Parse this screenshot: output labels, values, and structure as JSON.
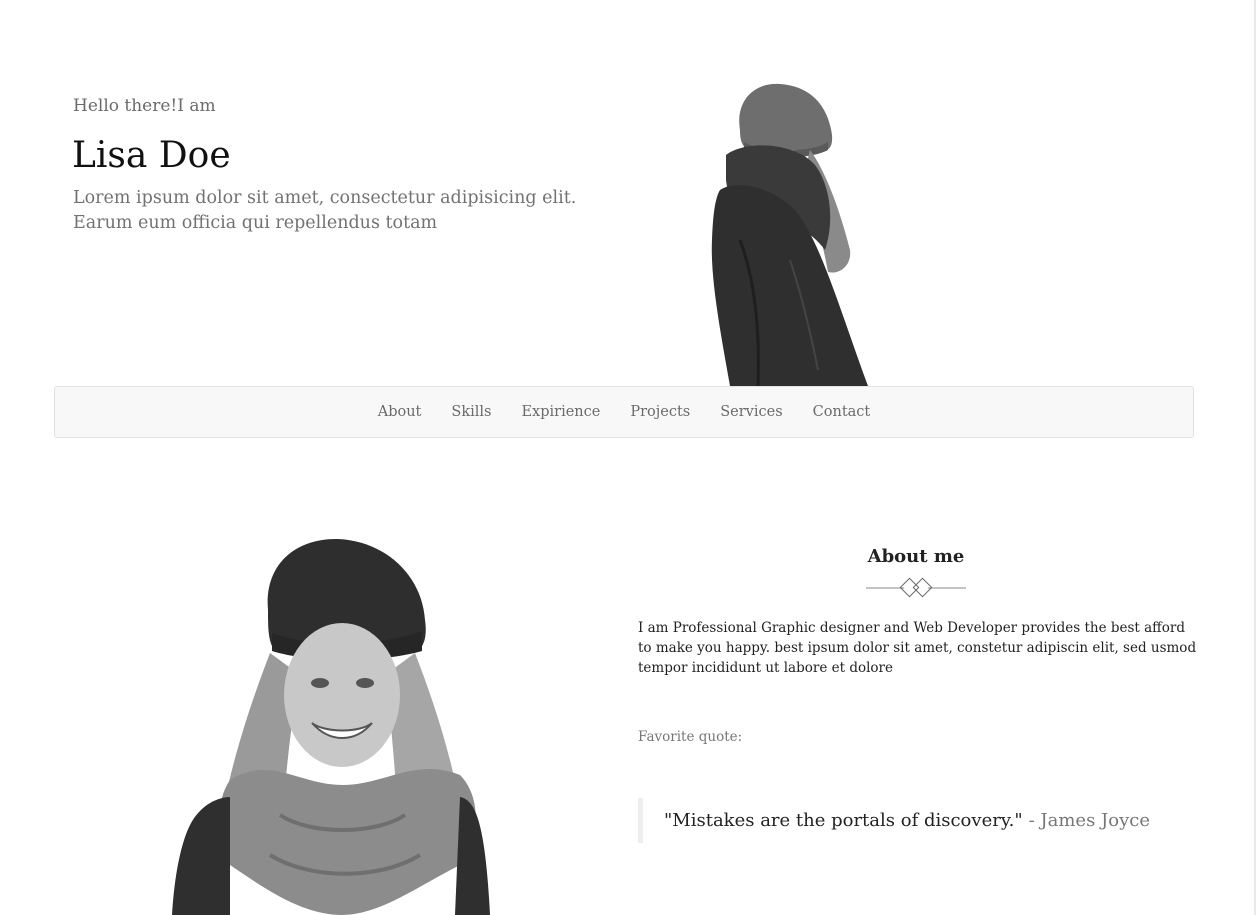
{
  "hero": {
    "greeting": "Hello there!I am",
    "name": "Lisa Doe",
    "intro": "Lorem ipsum dolor sit amet, consectetur adipisicing elit. Earum eum officia qui repellendus totam"
  },
  "nav": {
    "items": [
      {
        "label": "About"
      },
      {
        "label": "Skills"
      },
      {
        "label": "Expirience"
      },
      {
        "label": "Projects"
      },
      {
        "label": "Services"
      },
      {
        "label": "Contact"
      }
    ]
  },
  "about": {
    "title": "About me",
    "text": "I am Professional Graphic designer and Web Developer provides the best afford to make you happy. best ipsum dolor sit amet, constetur adipiscin elit, sed usmod tempor incididunt ut labore et dolore",
    "favorite_label": "Favorite quote:",
    "quote": "\"Mistakes are the portals of discovery.\"",
    "quote_author": "- James Joyce"
  },
  "colors": {
    "nav_bg": "#f8f8f8",
    "text_muted": "#777777",
    "text_dark": "#111111"
  }
}
